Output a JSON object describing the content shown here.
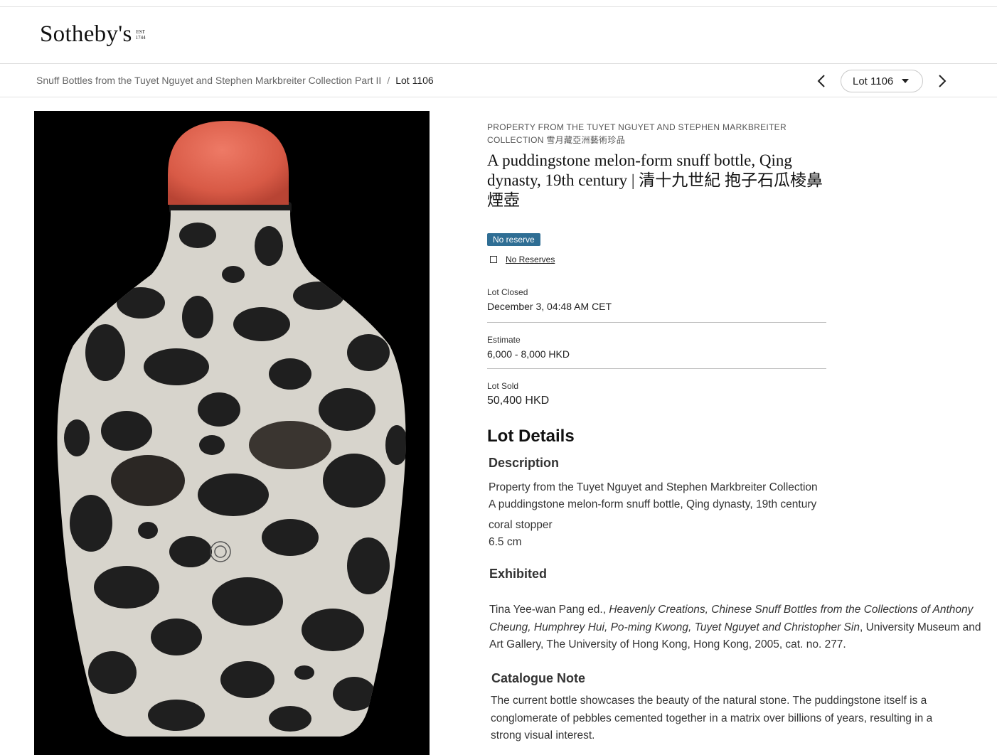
{
  "header": {
    "logo_text": "Sotheby's",
    "logo_est_label": "EST",
    "logo_est_year": "1744"
  },
  "breadcrumb": {
    "sale": "Snuff Bottles from the Tuyet Nguyet and Stephen Markbreiter Collection Part II",
    "separator": "/",
    "current": "Lot 1106"
  },
  "lot_nav": {
    "selected": "Lot 1106"
  },
  "lot": {
    "property": "PROPERTY FROM THE TUYET NGUYET AND STEPHEN MARKBREITER COLLECTION 雪月藏亞洲藝術珍品",
    "title": "A puddingstone melon-form snuff bottle, Qing dynasty, 19th century | 清十九世紀 抱子石瓜棱鼻煙壺",
    "badge": "No reserve",
    "no_reserves_filter": "No Reserves",
    "closed_label": "Lot Closed",
    "closed_value": "December 3, 04:48 AM CET",
    "estimate_label": "Estimate",
    "estimate_value": "6,000 - 8,000 HKD",
    "sold_label": "Lot Sold",
    "sold_value": "50,400 HKD"
  },
  "details": {
    "heading": "Lot Details",
    "description_heading": "Description",
    "description_lines": [
      "Property from the Tuyet Nguyet and Stephen Markbreiter Collection",
      "A puddingstone melon-form snuff bottle, Qing dynasty, 19th century",
      "coral stopper",
      "6.5 cm"
    ],
    "exhibited_heading": "Exhibited",
    "exhibited_prefix": "Tina Yee-wan Pang ed., ",
    "exhibited_italic": "Heavenly Creations, Chinese Snuff Bottles from the Collections of Anthony Cheung, Humphrey Hui, Po-ming Kwong, Tuyet Nguyet and Christopher Sin",
    "exhibited_suffix": ", University Museum and Art Gallery, The University of Hong Kong, Hong Kong, 2005, cat. no. 277.",
    "catalogue_heading": "Catalogue Note",
    "catalogue_text": "The current bottle showcases the beauty of the natural stone. The puddingstone itself is a conglomerate of pebbles cemented together in a matrix over billions of years, resulting in a strong visual interest."
  },
  "colors": {
    "badge_bg": "#2f6e94",
    "coral": "#e0604c",
    "image_bg": "#000000"
  }
}
